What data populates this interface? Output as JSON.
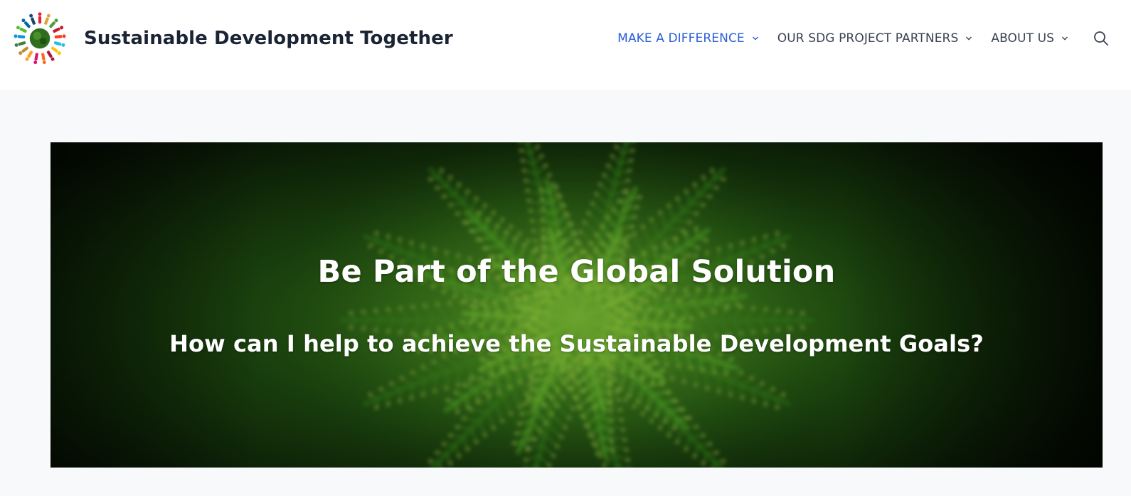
{
  "header": {
    "site_title": "Sustainable Development Together",
    "logo_icon": "sdg-wheel-logo-icon",
    "nav": [
      {
        "label": "MAKE A DIFFERENCE",
        "icon": "chevron-down-icon",
        "active": true
      },
      {
        "label": "OUR SDG PROJECT PARTNERS",
        "icon": "chevron-down-icon",
        "active": false
      },
      {
        "label": "ABOUT US",
        "icon": "chevron-down-icon",
        "active": false
      }
    ],
    "search_icon": "search-icon"
  },
  "hero": {
    "title": "Be Part of the Global Solution",
    "subtitle": "How can I help to achieve the Sustainable Development Goals?",
    "background": "green-fern-plant-photo"
  },
  "colors": {
    "nav_active": "#2b5fd6",
    "nav_text": "#3a4352",
    "title_text": "#1b2434",
    "page_bg": "#f8f9fb",
    "hero_green": "#3f8a1f"
  }
}
